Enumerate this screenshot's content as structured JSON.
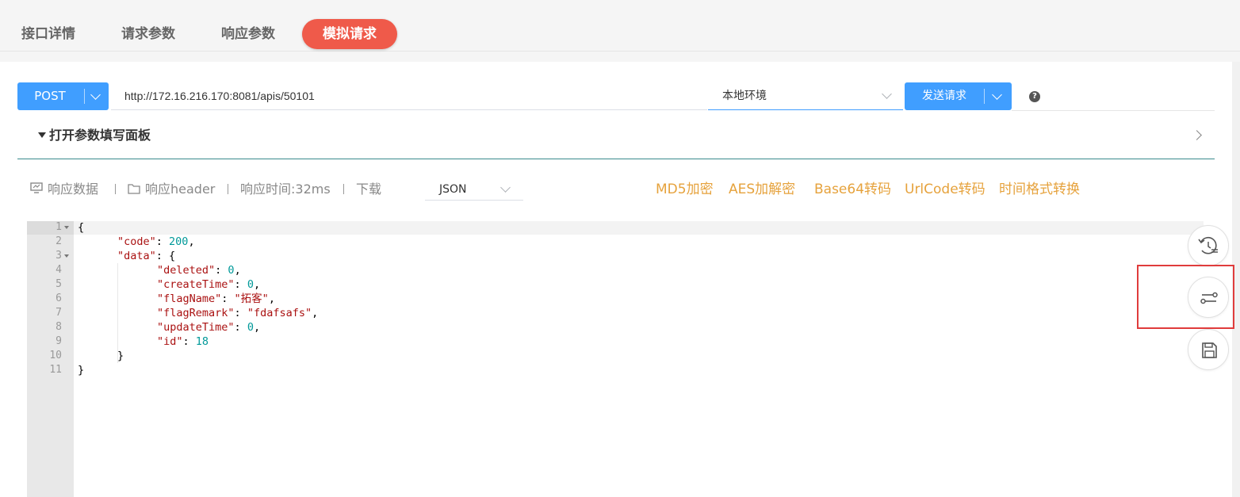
{
  "tabs": [
    {
      "label": "接口详情"
    },
    {
      "label": "请求参数"
    },
    {
      "label": "响应参数"
    },
    {
      "label": "模拟请求",
      "active": true
    }
  ],
  "request": {
    "method": "POST",
    "url": "http://172.16.216.170:8081/apis/50101",
    "environment": "本地环境",
    "send_label": "发送请求",
    "help": "?"
  },
  "params_panel": {
    "toggle_label": "打开参数填写面板"
  },
  "response_toolbar": {
    "data_label": "响应数据",
    "header_label": "响应header",
    "time_label": "响应时间:32ms",
    "download_label": "下载",
    "format": "JSON",
    "tools": [
      "MD5加密",
      "AES加解密",
      "Base64转码",
      "UrlCode转码",
      "时间格式转换"
    ]
  },
  "code": {
    "line_numbers": [
      "1",
      "2",
      "3",
      "4",
      "5",
      "6",
      "7",
      "8",
      "9",
      "10",
      "11"
    ],
    "lines": [
      {
        "tokens": [
          {
            "t": "{",
            "c": ""
          }
        ]
      },
      {
        "tokens": [
          {
            "t": "\"code\"",
            "c": "k"
          },
          {
            "t": ": ",
            "c": ""
          },
          {
            "t": "200",
            "c": "n"
          },
          {
            "t": ",",
            "c": ""
          }
        ]
      },
      {
        "tokens": [
          {
            "t": "\"data\"",
            "c": "k"
          },
          {
            "t": ": {",
            "c": ""
          }
        ]
      },
      {
        "tokens": [
          {
            "t": "\"deleted\"",
            "c": "k"
          },
          {
            "t": ": ",
            "c": ""
          },
          {
            "t": "0",
            "c": "n"
          },
          {
            "t": ",",
            "c": ""
          }
        ]
      },
      {
        "tokens": [
          {
            "t": "\"createTime\"",
            "c": "k"
          },
          {
            "t": ": ",
            "c": ""
          },
          {
            "t": "0",
            "c": "n"
          },
          {
            "t": ",",
            "c": ""
          }
        ]
      },
      {
        "tokens": [
          {
            "t": "\"flagName\"",
            "c": "k"
          },
          {
            "t": ": ",
            "c": ""
          },
          {
            "t": "\"拓客\"",
            "c": "s"
          },
          {
            "t": ",",
            "c": ""
          }
        ]
      },
      {
        "tokens": [
          {
            "t": "\"flagRemark\"",
            "c": "k"
          },
          {
            "t": ": ",
            "c": ""
          },
          {
            "t": "\"fdafsafs\"",
            "c": "s"
          },
          {
            "t": ",",
            "c": ""
          }
        ]
      },
      {
        "tokens": [
          {
            "t": "\"updateTime\"",
            "c": "k"
          },
          {
            "t": ": ",
            "c": ""
          },
          {
            "t": "0",
            "c": "n"
          },
          {
            "t": ",",
            "c": ""
          }
        ]
      },
      {
        "tokens": [
          {
            "t": "\"id\"",
            "c": "k"
          },
          {
            "t": ": ",
            "c": ""
          },
          {
            "t": "18",
            "c": "n"
          }
        ]
      },
      {
        "tokens": [
          {
            "t": "}",
            "c": ""
          }
        ]
      },
      {
        "tokens": [
          {
            "t": "}",
            "c": ""
          }
        ]
      }
    ]
  },
  "side_buttons": [
    {
      "icon": "history-icon"
    },
    {
      "icon": "settings-sliders-icon",
      "highlighted": true
    },
    {
      "icon": "save-icon"
    }
  ],
  "colors": {
    "primary": "#409eff",
    "active_tab": "#ef5a4a",
    "tool_link": "#e6a23c",
    "highlight": "#e03c3c"
  }
}
